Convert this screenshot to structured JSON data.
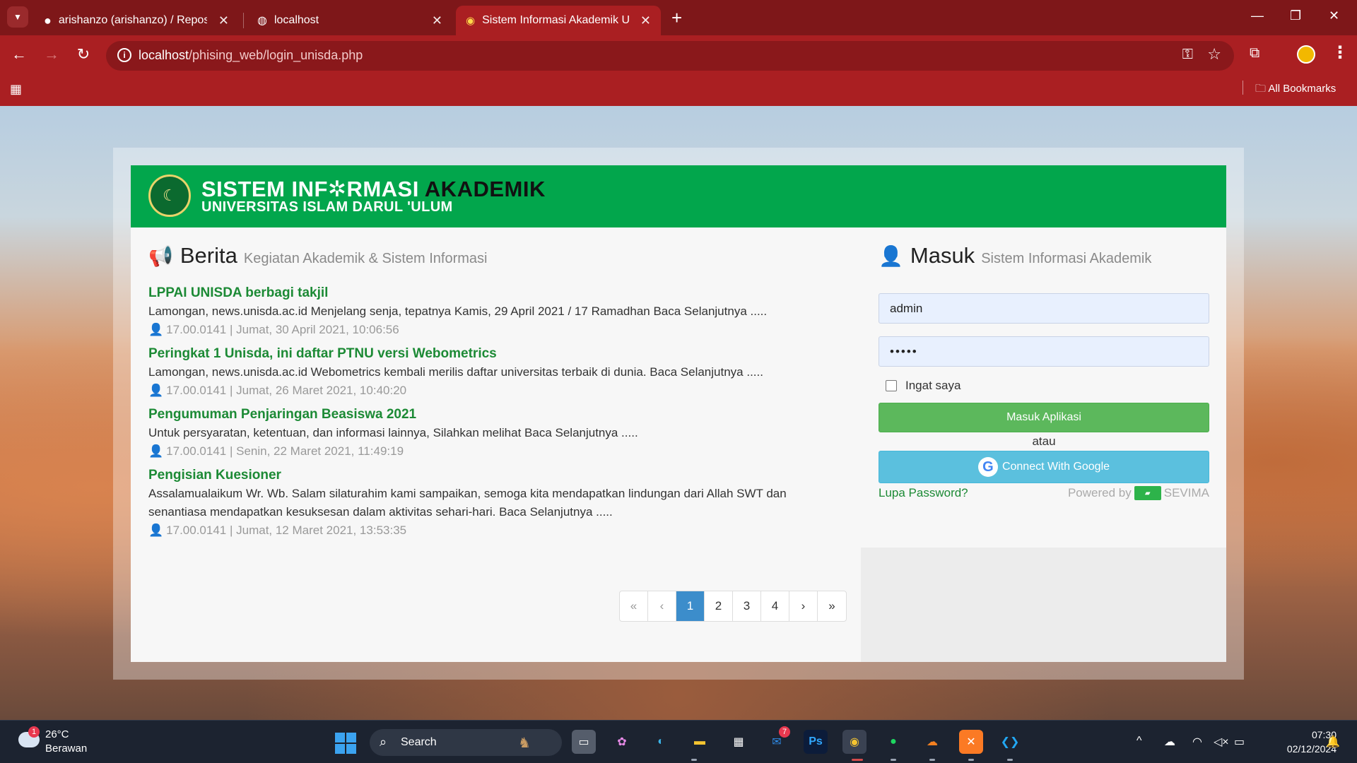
{
  "browser": {
    "tabs": [
      {
        "title": "arishanzo (arishanzo) / Reposito",
        "icon": "github-icon"
      },
      {
        "title": "localhost",
        "icon": "globe-icon"
      },
      {
        "title": "Sistem Informasi Akademik Uni",
        "icon": "unisda-favicon",
        "active": true
      }
    ],
    "url_host": "localhost",
    "url_path": "/phising_web/login_unisda.php",
    "bookmarks_label": "All Bookmarks",
    "accent_color": "#aa1f22"
  },
  "banner": {
    "title_part1": "SISTEM INF",
    "title_gear": "✲",
    "title_part2": "RMASI ",
    "title_part3": "AKADEMIK",
    "subtitle": "UNIVERSITAS ISLAM DARUL 'ULUM",
    "color": "#02a64c"
  },
  "news": {
    "heading": "Berita",
    "subheading": "Kegiatan Akademik & Sistem Informasi",
    "items": [
      {
        "title": "LPPAI UNISDA berbagi takjil",
        "body": "Lamongan, news.unisda.ac.id  Menjelang senja, tepatnya Kamis, 29 April 2021 / 17 Ramadhan  Baca Selanjutnya .....",
        "meta": "17.00.0141 | Jumat, 30 April 2021, 10:06:56"
      },
      {
        "title": "Peringkat 1 Unisda, ini daftar PTNU versi Webometrics",
        "body": "Lamongan, news.unisda.ac.id Webometrics kembali merilis daftar universitas terbaik di dunia. Baca Selanjutnya .....",
        "meta": "17.00.0141 | Jumat, 26 Maret 2021, 10:40:20"
      },
      {
        "title": "Pengumuman Penjaringan Beasiswa 2021",
        "body": "Untuk persyaratan, ketentuan, dan informasi lainnya, Silahkan melihat Baca Selanjutnya .....",
        "meta": "17.00.0141 | Senin, 22 Maret 2021, 11:49:19"
      },
      {
        "title": "Pengisian Kuesioner",
        "body": "Assalamualaikum Wr. Wb. Salam silaturahim kami sampaikan, semoga kita mendapatkan lindungan dari Allah SWT dan senantiasa mendapatkan kesuksesan dalam aktivitas sehari-hari. Baca Selanjutnya .....",
        "meta": "17.00.0141 | Jumat, 12 Maret 2021, 13:53:35"
      }
    ],
    "pagination": {
      "first": "«",
      "prev": "‹",
      "pages": [
        "1",
        "2",
        "3",
        "4"
      ],
      "current": "1",
      "next": "›",
      "last": "»"
    }
  },
  "login": {
    "heading": "Masuk",
    "subheading": "Sistem Informasi Akademik",
    "username_value": "admin",
    "password_value": "•••••",
    "remember_label": "Ingat saya",
    "remember_checked": false,
    "submit_label": "Masuk Aplikasi",
    "or_label": "atau",
    "google_label": "Connect With Google",
    "forgot_label": "Lupa Password?",
    "powered_label": "Powered by",
    "powered_brand": "SEVIMA",
    "submit_color": "#5cb85c",
    "google_color": "#5bc0de"
  },
  "taskbar": {
    "weather_temp": "26°C",
    "weather_desc": "Berawan",
    "weather_badge": "1",
    "search_label": "Search",
    "app_badge": "7",
    "time": "07:30",
    "date": "02/12/2024"
  }
}
